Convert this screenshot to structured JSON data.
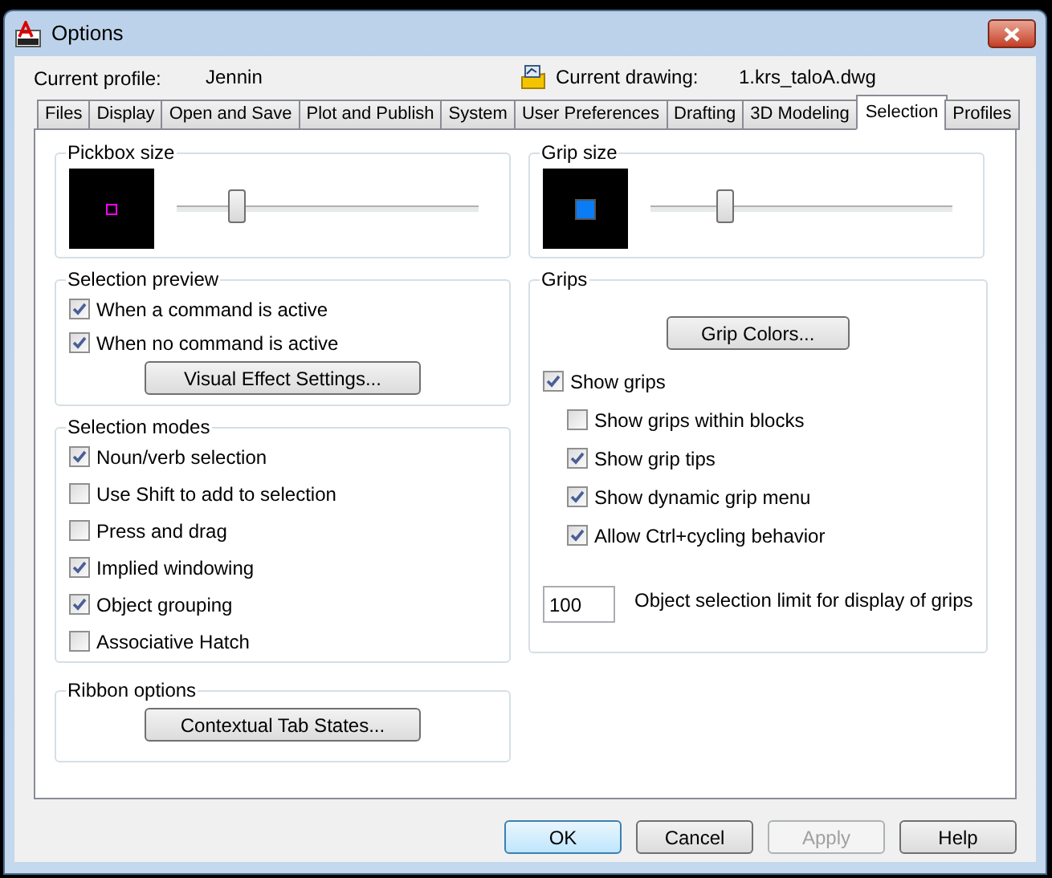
{
  "window": {
    "title": "Options"
  },
  "profile": {
    "label": "Current profile:",
    "value": "Jennin"
  },
  "drawing": {
    "label": "Current drawing:",
    "value": "1.krs_taloA.dwg"
  },
  "tabs": [
    {
      "label": "Files",
      "selected": false
    },
    {
      "label": "Display",
      "selected": false
    },
    {
      "label": "Open and Save",
      "selected": false
    },
    {
      "label": "Plot and Publish",
      "selected": false
    },
    {
      "label": "System",
      "selected": false
    },
    {
      "label": "User Preferences",
      "selected": false
    },
    {
      "label": "Drafting",
      "selected": false
    },
    {
      "label": "3D Modeling",
      "selected": false
    },
    {
      "label": "Selection",
      "selected": true
    },
    {
      "label": "Profiles",
      "selected": false
    }
  ],
  "pickbox": {
    "title": "Pickbox size",
    "level": 0.17
  },
  "selection_preview": {
    "title": "Selection preview",
    "options": [
      {
        "label": "When a command is active",
        "checked": true
      },
      {
        "label": "When no command is active",
        "checked": true
      }
    ],
    "button": "Visual Effect Settings..."
  },
  "selection_modes": {
    "title": "Selection modes",
    "options": [
      {
        "label": "Noun/verb selection",
        "checked": true
      },
      {
        "label": "Use Shift to add to selection",
        "checked": false
      },
      {
        "label": "Press and drag",
        "checked": false
      },
      {
        "label": "Implied windowing",
        "checked": true
      },
      {
        "label": "Object grouping",
        "checked": true
      },
      {
        "label": "Associative Hatch",
        "checked": false
      }
    ]
  },
  "ribbon_options": {
    "title": "Ribbon options",
    "button": "Contextual Tab States..."
  },
  "grip_size": {
    "title": "Grip size",
    "level": 0.22
  },
  "grips": {
    "title": "Grips",
    "button": "Grip Colors...",
    "options": [
      {
        "label": "Show grips",
        "checked": true,
        "children": [
          {
            "label": "Show grips within blocks",
            "checked": false
          },
          {
            "label": "Show grip tips",
            "checked": true
          },
          {
            "label": "Show dynamic grip menu",
            "checked": true
          },
          {
            "label": "Allow Ctrl+cycling behavior",
            "checked": true
          }
        ]
      }
    ],
    "limit": {
      "value": "100",
      "label": "Object selection limit for display of grips"
    }
  },
  "buttons": [
    {
      "label": "OK",
      "kind": "default",
      "disabled": false
    },
    {
      "label": "Cancel",
      "kind": "normal",
      "disabled": false
    },
    {
      "label": "Apply",
      "kind": "normal",
      "disabled": true
    },
    {
      "label": "Help",
      "kind": "normal",
      "disabled": false
    }
  ]
}
